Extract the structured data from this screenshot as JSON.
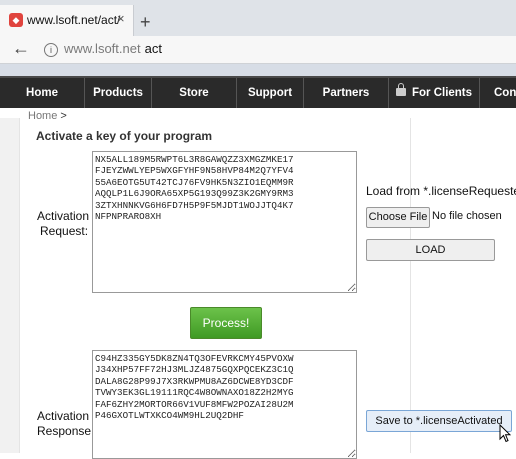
{
  "browser": {
    "tab_title": "www.lsoft.net/act/",
    "tab_close": "×",
    "new_tab": "+",
    "back": "←",
    "url_domain": "www.lsoft.net",
    "url_path": "act"
  },
  "nav": {
    "items": [
      "Home",
      "Products",
      "Store",
      "Support",
      "Partners",
      "For Clients",
      "Cont"
    ]
  },
  "breadcrumb": {
    "home": "Home",
    "separator": ">"
  },
  "page": {
    "heading": "Activate a key of your program",
    "request_label_1": "Activation",
    "request_label_2": "Request:",
    "request_value": "NX5ALL189M5RWPT6L3R8GAWQZZ3XMGZMKE17\nFJEYZWWLYEP5WXGFYHF9N58HVP84M2Q7YFV4\n55A6EOTG5UT42TCJ76FV9HK5N3ZIO1EQMM9R\nAQQLP1L6J9ORA65XP5G193Q99Z3K2GMY9RM3\n3ZTXHNNKVG6H6FD7H5P9F5MJDT1WOJJTQ4K7\nNFPNPRARO8XH",
    "response_label_1": "Activation",
    "response_label_2": "Response:",
    "response_value": "C94HZ335GY5DK8ZN4TQ3OFEVRKCMY45PVOXW\nJ34XHP57FF72HJ3MLJZ4875GQXPQCEKZ3C1Q\nDALA8G28P99J7X3RKWPMU8AZ6DCWE8YD3CDF\nTVWY3EK3GL19111RQC4W8OWNAXO18Z2H2MYG\nFAF6ZHY2MORTOR66V1VUF8MFW2POZAI28U2M\nP46GXOTLWTXKCO4WM9HL2UQ2DHF",
    "process_button": "Process!",
    "load_from": "Load from *.licenseRequested",
    "choose_file": "Choose File",
    "no_file": "No file chosen",
    "load_button": "LOAD",
    "save_button": "Save to *.licenseActivated"
  },
  "colors": {
    "nav_bg": "#2a2a2a",
    "process_green": "#4caf34",
    "favicon_red": "#e0443e"
  },
  "icons": [
    "favicon-icon",
    "close-icon",
    "new-tab-icon",
    "back-arrow-icon",
    "info-icon",
    "lock-icon",
    "mouse-cursor-icon"
  ]
}
